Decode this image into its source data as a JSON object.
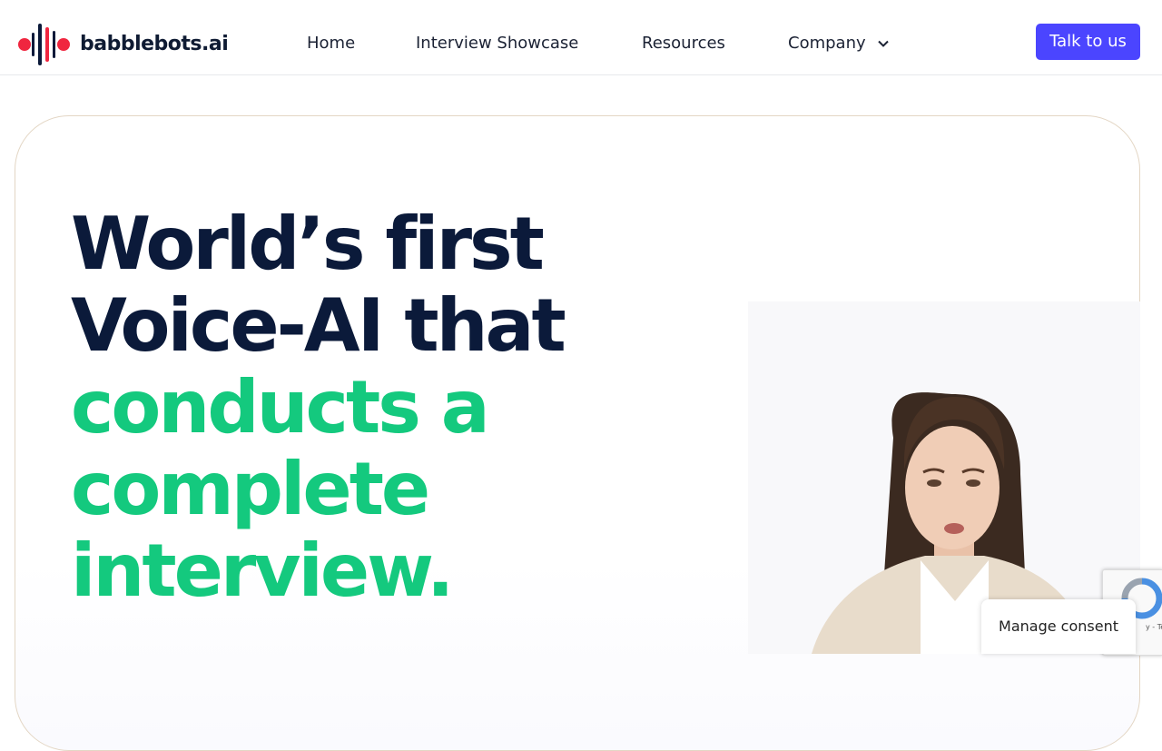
{
  "header": {
    "logo_text": "babblebots.ai",
    "nav": [
      {
        "label": "Home"
      },
      {
        "label": "Interview Showcase"
      },
      {
        "label": "Resources"
      },
      {
        "label": "Company"
      }
    ],
    "cta_label": "Talk to us"
  },
  "hero": {
    "line1": "World’s first",
    "line2": "Voice-AI that",
    "line3": "conducts a",
    "line4": "complete",
    "line5": "interview."
  },
  "overlays": {
    "consent_label": "Manage consent",
    "recaptcha_text": "y - Te"
  },
  "colors": {
    "brand_blue": "#4b45ff",
    "brand_red": "#f0263f",
    "headline_dark": "#0b1a3a",
    "headline_green": "#14c97e"
  },
  "icons": [
    "babblebots-logo-icon",
    "chevron-down-icon",
    "recaptcha-icon"
  ]
}
